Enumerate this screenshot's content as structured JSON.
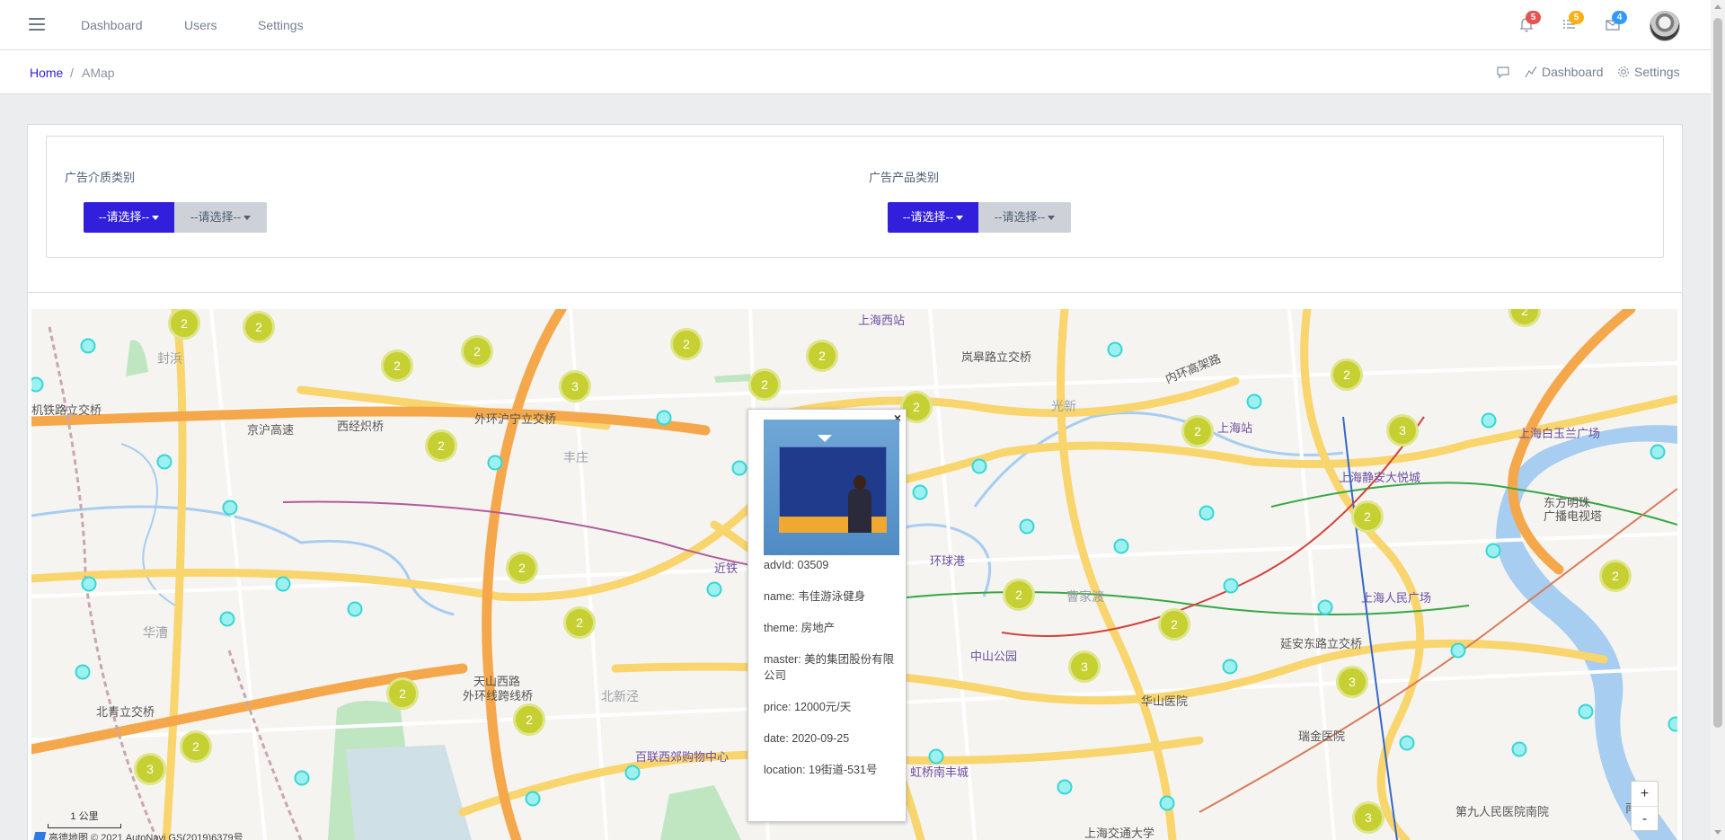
{
  "header": {
    "nav": [
      {
        "label": "Dashboard"
      },
      {
        "label": "Users"
      },
      {
        "label": "Settings"
      }
    ],
    "icons": [
      {
        "name": "bell-icon",
        "count": "5",
        "color": "#e55353"
      },
      {
        "name": "list-icon",
        "count": "5",
        "color": "#f9b115"
      },
      {
        "name": "envelope-icon",
        "count": "4",
        "color": "#3399ff"
      }
    ]
  },
  "breadcrumb": {
    "home": "Home",
    "separator": "/",
    "current": "AMap"
  },
  "subheader_links": {
    "dashboard": "Dashboard",
    "settings": "Settings"
  },
  "filters": {
    "media": {
      "label": "广告介质类别",
      "select1": "--请选择--",
      "select2": "--请选择--"
    },
    "product": {
      "label": "广告产品类别",
      "select1": "--请选择--",
      "select2": "--请选择--"
    }
  },
  "map": {
    "labels": [
      {
        "text": "上海西站",
        "kind": "poi"
      },
      {
        "text": "封浜",
        "kind": "grey"
      },
      {
        "text": "岚皋路立交桥",
        "kind": "road"
      },
      {
        "text": "光新",
        "kind": "grey"
      },
      {
        "text": "内环高架路",
        "kind": "road"
      },
      {
        "text": "机铁路立交桥",
        "kind": "road"
      },
      {
        "text": "京沪高速",
        "kind": "road"
      },
      {
        "text": "西经炽桥",
        "kind": "road"
      },
      {
        "text": "外环沪宁立交桥",
        "kind": "road"
      },
      {
        "text": "丰庄",
        "kind": "grey"
      },
      {
        "text": "上海站",
        "kind": "poi"
      },
      {
        "text": "上海白玉兰广场",
        "kind": "poi"
      },
      {
        "text": "上海静安大悦城",
        "kind": "poi"
      },
      {
        "text": "东方明珠",
        "kind": "road"
      },
      {
        "text": "广播电视塔",
        "kind": "road"
      },
      {
        "text": "环球港",
        "kind": "poi"
      },
      {
        "text": "近铁",
        "kind": "poi"
      },
      {
        "text": "曹家渡",
        "kind": "grey"
      },
      {
        "text": "上海人民广场",
        "kind": "poi"
      },
      {
        "text": "华漕",
        "kind": "grey"
      },
      {
        "text": "中山公园",
        "kind": "poi"
      },
      {
        "text": "延安东路立交桥",
        "kind": "road"
      },
      {
        "text": "天山西路",
        "kind": "road"
      },
      {
        "text": "外环线跨线桥",
        "kind": "road"
      },
      {
        "text": "北新泾",
        "kind": "grey"
      },
      {
        "text": "北青立交桥",
        "kind": "road"
      },
      {
        "text": "华山医院",
        "kind": "road"
      },
      {
        "text": "瑞金医院",
        "kind": "road"
      },
      {
        "text": "百联西郊购物中心",
        "kind": "poi"
      },
      {
        "text": "虹桥南丰城",
        "kind": "poi"
      },
      {
        "text": "第九人民医院南院",
        "kind": "road"
      },
      {
        "text": "南浦",
        "kind": "road"
      },
      {
        "text": "上海交通大学",
        "kind": "road"
      }
    ],
    "clusters": [
      "2",
      "2",
      "2",
      "2",
      "3",
      "2",
      "2",
      "2",
      "2",
      "2",
      "2",
      "3",
      "2",
      "2",
      "2",
      "2",
      "2",
      "3",
      "2",
      "2",
      "2",
      "2",
      "2",
      "3",
      "2",
      "3",
      "3"
    ],
    "scale": "1 公里",
    "zoom_in": "+",
    "zoom_out": "-",
    "copyright": "高德地图 © 2021 AutoNavi GS(2019)6379号"
  },
  "infowindow": {
    "close": "×",
    "advId": "advId: 03509",
    "name": "name: 韦佳游泳健身",
    "theme": "theme: 房地产",
    "master": "master: 美的集团股份有限公司",
    "price": "price: 12000元/天",
    "date": "date: 2020-09-25",
    "location": "location: 19街道-531号"
  },
  "colors": {
    "primary": "#321fdb",
    "secondary": "#ced2d8",
    "cluster": "#c6d033",
    "marker": "#35d7d6"
  }
}
